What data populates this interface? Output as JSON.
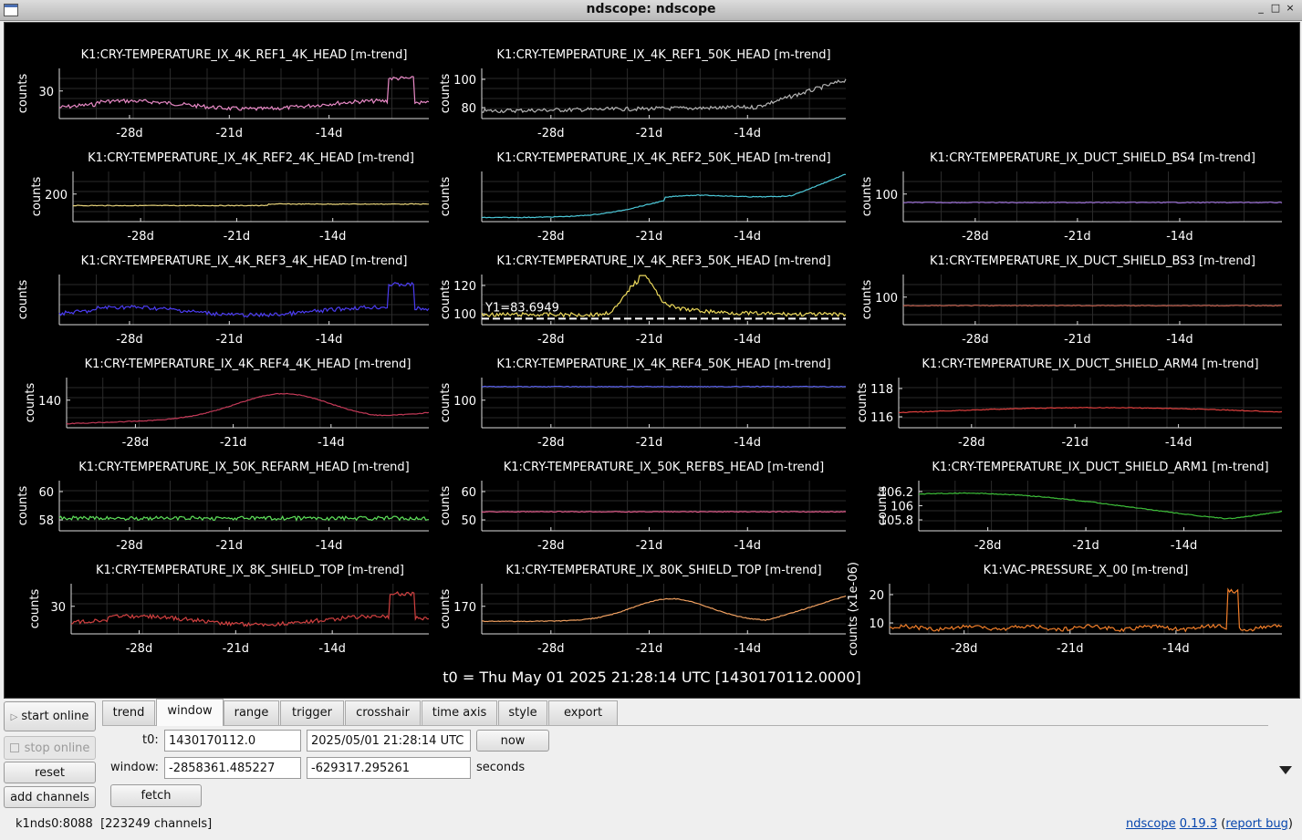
{
  "window": {
    "title": "ndscope: ndscope",
    "minimize": "_",
    "maximize": "□",
    "close": "×"
  },
  "plots": [
    {
      "title": "K1:CRY-TEMPERATURE_IX_4K_REF1_4K_HEAD [m-trend]",
      "ylabel": "counts",
      "yticks": [
        "30"
      ],
      "xticks": [
        "-28d",
        "-21d",
        "-14d"
      ],
      "color": "#e889c6",
      "kind": "noisy_step"
    },
    {
      "title": "K1:CRY-TEMPERATURE_IX_4K_REF1_50K_HEAD [m-trend]",
      "ylabel": "counts",
      "yticks": [
        "100",
        "80"
      ],
      "xticks": [
        "-28d",
        "-21d",
        "-14d"
      ],
      "color": "#b4b4b4",
      "kind": "rise_late"
    },
    {
      "title": "K1:CRY-TEMPERATURE_IX_4K_REF2_4K_HEAD [m-trend]",
      "ylabel": "counts",
      "yticks": [
        "200"
      ],
      "xticks": [
        "-28d",
        "-21d",
        "-14d"
      ],
      "color": "#e6d27a",
      "kind": "flat_low"
    },
    {
      "title": "K1:CRY-TEMPERATURE_IX_4K_REF2_50K_HEAD [m-trend]",
      "ylabel": "counts",
      "yticks": [],
      "xticks": [
        "-28d",
        "-21d",
        "-14d"
      ],
      "color": "#4cc9d9",
      "kind": "smooth_rise"
    },
    {
      "title": "K1:CRY-TEMPERATURE_IX_DUCT_SHIELD_BS4 [m-trend]",
      "ylabel": "counts",
      "yticks": [
        "100"
      ],
      "xticks": [
        "-28d",
        "-21d",
        "-14d"
      ],
      "color": "#9b6fd6",
      "kind": "flat"
    },
    {
      "title": "K1:CRY-TEMPERATURE_IX_4K_REF3_4K_HEAD [m-trend]",
      "ylabel": "counts",
      "yticks": [],
      "xticks": [
        "-28d",
        "-21d",
        "-14d"
      ],
      "color": "#4b3cf0",
      "kind": "noisy_step"
    },
    {
      "title": "K1:CRY-TEMPERATURE_IX_4K_REF3_50K_HEAD [m-trend]",
      "ylabel": "counts",
      "yticks": [
        "120",
        "100"
      ],
      "xticks": [
        "-28d",
        "-21d",
        "-14d"
      ],
      "color": "#ecd95c",
      "kind": "peak",
      "cursor": "Y1=83.6949"
    },
    {
      "title": "K1:CRY-TEMPERATURE_IX_DUCT_SHIELD_BS3 [m-trend]",
      "ylabel": "counts",
      "yticks": [
        "100"
      ],
      "xticks": [
        "-28d",
        "-21d",
        "-14d"
      ],
      "color": "#c2604e",
      "kind": "flat"
    },
    {
      "title": "K1:CRY-TEMPERATURE_IX_4K_REF4_4K_HEAD [m-trend]",
      "ylabel": "counts",
      "yticks": [
        "140"
      ],
      "xticks": [
        "-28d",
        "-21d",
        "-14d"
      ],
      "color": "#c43a58",
      "kind": "hump"
    },
    {
      "title": "K1:CRY-TEMPERATURE_IX_4K_REF4_50K_HEAD [m-trend]",
      "ylabel": "counts",
      "yticks": [
        "100"
      ],
      "xticks": [
        "-28d",
        "-21d",
        "-14d"
      ],
      "color": "#5a62f0",
      "kind": "flat_high"
    },
    {
      "title": "K1:CRY-TEMPERATURE_IX_DUCT_SHIELD_ARM4 [m-trend]",
      "ylabel": "counts",
      "yticks": [
        "118",
        "116"
      ],
      "xticks": [
        "-28d",
        "-21d",
        "-14d"
      ],
      "color": "#e0403e",
      "kind": "gentle"
    },
    {
      "title": "K1:CRY-TEMPERATURE_IX_50K_REFARM_HEAD [m-trend]",
      "ylabel": "counts",
      "yticks": [
        "60",
        "58"
      ],
      "xticks": [
        "-28d",
        "-21d",
        "-14d"
      ],
      "color": "#5ee05a",
      "kind": "flat_noisy"
    },
    {
      "title": "K1:CRY-TEMPERATURE_IX_50K_REFBS_HEAD [m-trend]",
      "ylabel": "counts",
      "yticks": [
        "60",
        "50"
      ],
      "xticks": [
        "-28d",
        "-21d",
        "-14d"
      ],
      "color": "#e05a8a",
      "kind": "flat"
    },
    {
      "title": "K1:CRY-TEMPERATURE_IX_DUCT_SHIELD_ARM1 [m-trend]",
      "ylabel": "counts",
      "yticks": [
        "106.2",
        "106",
        "105.8"
      ],
      "xticks": [
        "-28d",
        "-21d",
        "-14d"
      ],
      "color": "#3ec03a",
      "kind": "dip_rise"
    },
    {
      "title": "K1:CRY-TEMPERATURE_IX_8K_SHIELD_TOP [m-trend]",
      "ylabel": "counts",
      "yticks": [
        "30"
      ],
      "xticks": [
        "-28d",
        "-21d",
        "-14d"
      ],
      "color": "#d04040",
      "kind": "noisy_step"
    },
    {
      "title": "K1:CRY-TEMPERATURE_IX_80K_SHIELD_TOP [m-trend]",
      "ylabel": "counts",
      "yticks": [
        "170"
      ],
      "xticks": [
        "-28d",
        "-21d",
        "-14d"
      ],
      "color": "#f0a060",
      "kind": "smooth_wave"
    },
    {
      "title": "K1:VAC-PRESSURE_X_00 [m-trend]",
      "ylabel": "counts (x1e-06)",
      "yticks": [
        "20",
        "10"
      ],
      "xticks": [
        "-28d",
        "-21d",
        "-14d"
      ],
      "color": "#f07e2a",
      "kind": "spike"
    }
  ],
  "t0_label": "t0 = Thu May 01 2025 21:28:14 UTC [1430170112.0000]",
  "controls": {
    "start_online": "start online",
    "stop_online": "stop online",
    "reset": "reset",
    "add_channels": "add channels",
    "tabs": [
      "trend",
      "window",
      "range",
      "trigger",
      "crosshair",
      "time axis",
      "style",
      "export"
    ],
    "active_tab": "window",
    "t0_label": "t0:",
    "t0_gps": "1430170112.0",
    "t0_utc": "2025/05/01 21:28:14 UTC",
    "now": "now",
    "window_label": "window:",
    "window_start": "-2858361.485227",
    "window_end": "-629317.295261",
    "seconds": "seconds",
    "fetch": "fetch"
  },
  "status": {
    "server": "k1nds0:8088",
    "channels": "[223249 channels]"
  },
  "version": {
    "app": "ndscope",
    "ver": "0.19.3",
    "open": " (",
    "report": "report bug",
    "close": ")"
  }
}
